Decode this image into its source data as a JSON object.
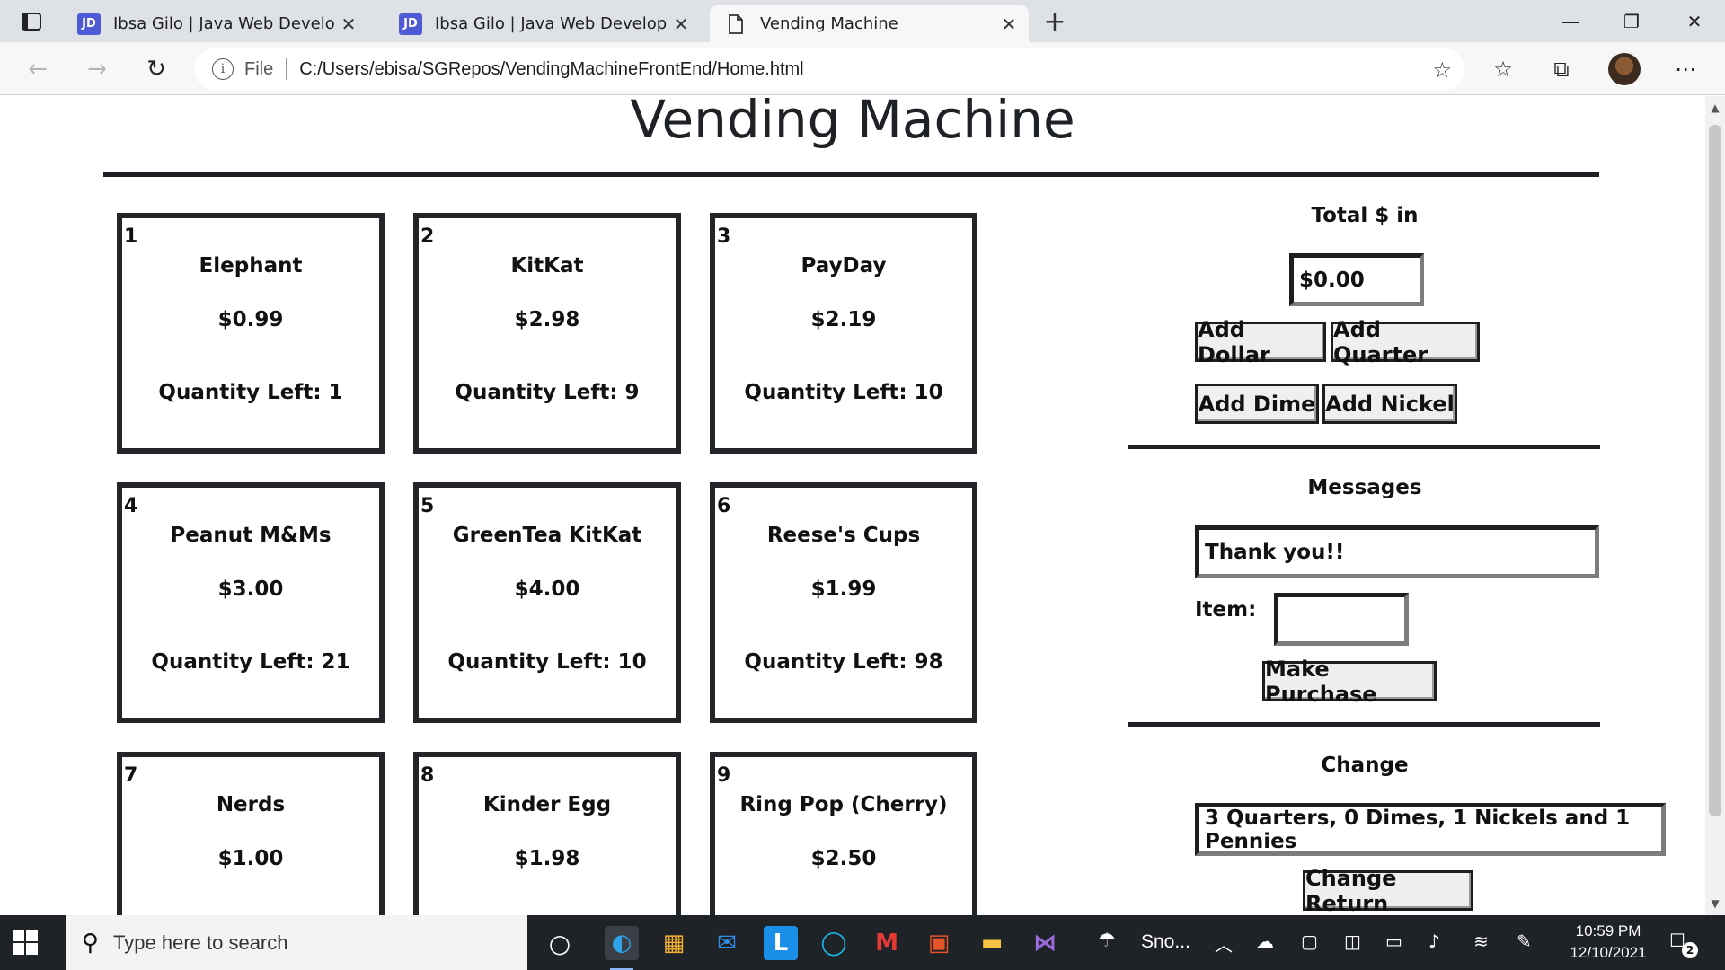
{
  "browser": {
    "tabs": [
      {
        "favicon": "JD",
        "title": "Ibsa Gilo | Java Web Developer",
        "active": false
      },
      {
        "favicon": "JD",
        "title": "Ibsa Gilo | Java Web Developer",
        "active": false
      },
      {
        "favicon": "page-icon",
        "title": "Vending Machine",
        "active": true
      }
    ],
    "address": {
      "scheme_label": "File",
      "url": "C:/Users/ebisa/SGRepos/VendingMachineFrontEnd/Home.html"
    }
  },
  "page": {
    "title": "Vending Machine",
    "items": [
      {
        "number": "1",
        "name": "Elephant",
        "price": "$0.99",
        "quantity": "Quantity Left: 1"
      },
      {
        "number": "2",
        "name": "KitKat",
        "price": "$2.98",
        "quantity": "Quantity Left: 9"
      },
      {
        "number": "3",
        "name": "PayDay",
        "price": "$2.19",
        "quantity": "Quantity Left: 10"
      },
      {
        "number": "4",
        "name": "Peanut M&Ms",
        "price": "$3.00",
        "quantity": "Quantity Left: 21"
      },
      {
        "number": "5",
        "name": "GreenTea KitKat",
        "price": "$4.00",
        "quantity": "Quantity Left: 10"
      },
      {
        "number": "6",
        "name": "Reese's Cups",
        "price": "$1.99",
        "quantity": "Quantity Left: 98"
      },
      {
        "number": "7",
        "name": "Nerds",
        "price": "$1.00",
        "quantity": ""
      },
      {
        "number": "8",
        "name": "Kinder Egg",
        "price": "$1.98",
        "quantity": ""
      },
      {
        "number": "9",
        "name": "Ring Pop (Cherry)",
        "price": "$2.50",
        "quantity": ""
      }
    ],
    "money": {
      "heading": "Total $ in",
      "total_value": "$0.00",
      "add_dollar": "Add Dollar",
      "add_quarter": "Add Quarter",
      "add_dime": "Add Dime",
      "add_nickel": "Add Nickel"
    },
    "messages": {
      "heading": "Messages",
      "message_value": "Thank you!!",
      "item_label": "Item:",
      "item_value": "",
      "purchase_button": "Make Purchase"
    },
    "change": {
      "heading": "Change",
      "change_value": "3 Quarters, 0 Dimes, 1 Nickels and 1 Pennies",
      "return_button": "Change Return"
    }
  },
  "taskbar": {
    "search_placeholder": "Type here to search",
    "weather_text": "Sno...",
    "time": "10:59 PM",
    "date": "12/10/2021",
    "notification_count": "2"
  }
}
